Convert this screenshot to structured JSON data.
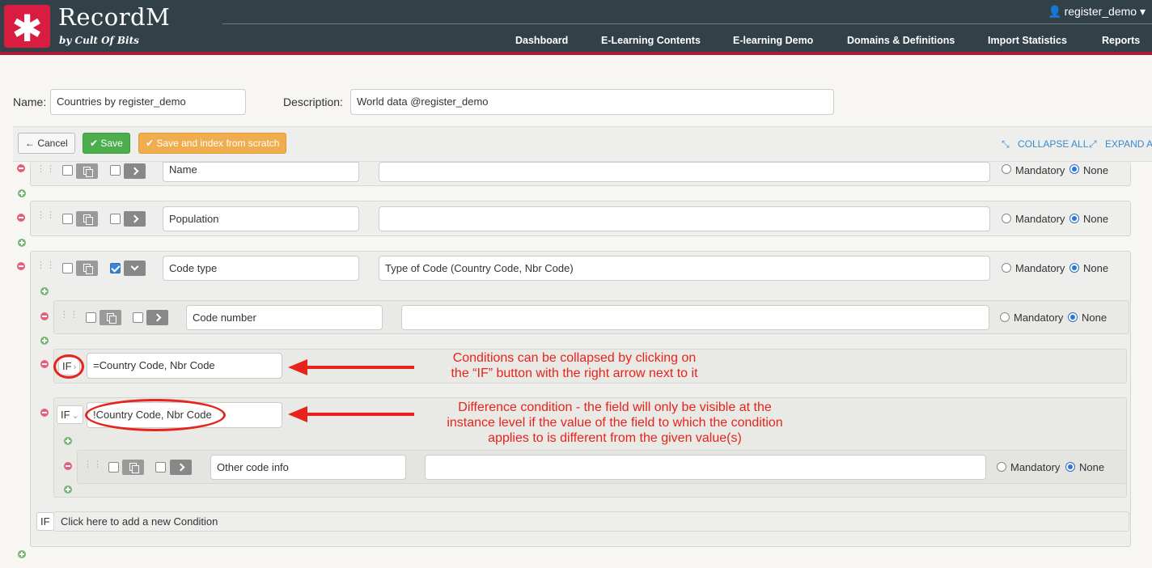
{
  "header": {
    "app_title": "RecordM",
    "app_subtitle": "by Cult Of Bits",
    "logo_glyph": "✱",
    "user": "register_demo",
    "user_caret": "▾",
    "nav": [
      "Dashboard",
      "E-Learning Contents",
      "E-learning Demo",
      "Domains & Definitions",
      "Import Statistics",
      "Reports"
    ]
  },
  "form": {
    "name_label": "Name:",
    "name_value": "Countries by register_demo",
    "description_label": "Description:",
    "description_value": "World data @register_demo"
  },
  "toolbar": {
    "cancel_label": "← Cancel",
    "save_label": "✔ Save",
    "save_index_label": "✔ Save and index from scratch",
    "collapse_label": "COLLAPSE ALL",
    "expand_label": "EXPAND ALL"
  },
  "fields": {
    "name": {
      "name": "Name",
      "description": "",
      "mandatory": "Mandatory",
      "none": "None"
    },
    "population": {
      "name": "Population",
      "description": "",
      "mandatory": "Mandatory",
      "none": "None"
    },
    "code_type": {
      "name": "Code type",
      "description": "Type of Code (Country Code, Nbr Code)",
      "mandatory": "Mandatory",
      "none": "None"
    },
    "code_number": {
      "name": "Code number",
      "description": "",
      "mandatory": "Mandatory",
      "none": "None"
    },
    "other_code_info": {
      "name": "Other code info",
      "description": "",
      "mandatory": "Mandatory",
      "none": "None"
    }
  },
  "conditions": {
    "cond1": {
      "if_label": "IF",
      "arrow": "›",
      "value": "=Country Code, Nbr Code"
    },
    "cond2": {
      "if_label": "IF",
      "arrow": "⌄",
      "value": "!Country Code, Nbr Code"
    },
    "add_if_label": "IF",
    "add_text": "Click here to add a new Condition"
  },
  "annotations": {
    "note1_line1": "Conditions can be collapsed by clicking on",
    "note1_line2": "the “IF” button with the right arrow next to it",
    "note2_line1": "Difference condition - the field will only be visible at the",
    "note2_line2": "instance level if the value of the field to which the condition",
    "note2_line3": "applies to is different from the given value(s)"
  },
  "colors": {
    "header_bg": "#324148",
    "brand_red": "#d81d40",
    "save_green": "#4cae4c",
    "save_index_orange": "#f0ad4e",
    "annotation_red": "#e8231b",
    "link_blue": "#3a8ad0"
  }
}
